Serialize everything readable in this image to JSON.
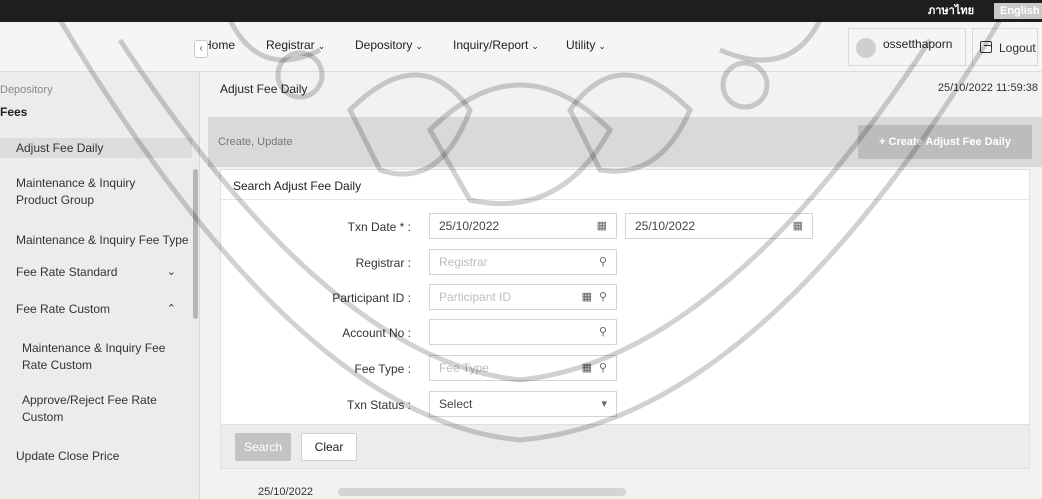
{
  "lang": {
    "thai": "ภาษาไทย",
    "english": "English"
  },
  "nav": {
    "items": [
      {
        "label": "Home",
        "has_menu": false
      },
      {
        "label": "Registrar",
        "has_menu": true
      },
      {
        "label": "Depository",
        "has_menu": true
      },
      {
        "label": "Inquiry/Report",
        "has_menu": true
      },
      {
        "label": "Utility",
        "has_menu": true
      }
    ],
    "user": "ossetthaporn",
    "logout": "Logout"
  },
  "sidebar": {
    "crumb": "Depository",
    "title": "Fees",
    "items": [
      {
        "label": "Adjust Fee Daily",
        "active": true
      },
      {
        "label": "Maintenance & Inquiry Product Group"
      },
      {
        "label": "Maintenance & Inquiry Fee Type"
      },
      {
        "label": "Fee Rate Standard",
        "arrow": "down"
      },
      {
        "label": "Fee Rate Custom",
        "arrow": "up"
      },
      {
        "label": "Maintenance & Inquiry Fee Rate Custom",
        "sub": true
      },
      {
        "label": "Approve/Reject Fee Rate Custom",
        "sub": true
      },
      {
        "label": "Update Close Price"
      }
    ]
  },
  "main": {
    "page_title": "Adjust Fee Daily",
    "timestamp": "25/10/2022 11:59:38",
    "action_label": "Create, Update",
    "create_button": "+ Create Adjust Fee Daily",
    "panel_title": "Search Adjust Fee Daily",
    "form": {
      "txn_date": {
        "label": "Txn Date * :",
        "from": "25/10/2022",
        "to": "25/10/2022"
      },
      "registrar": {
        "label": "Registrar :",
        "placeholder": "Registrar"
      },
      "participant_id": {
        "label": "Participant ID :",
        "placeholder": "Participant ID"
      },
      "account_no": {
        "label": "Account No :",
        "placeholder": ""
      },
      "fee_type": {
        "label": "Fee Type :",
        "placeholder": "Fee Type"
      },
      "txn_status": {
        "label": "Txn Status :",
        "value": "Select"
      }
    },
    "search_button": "Search",
    "clear_button": "Clear"
  },
  "footer": {
    "date": "25/10/2022"
  },
  "icons": {
    "calendar": "calendar-icon",
    "search": "search-icon",
    "lookup": "lookup-table-icon",
    "caret": "caret-down-icon",
    "logout": "logout-icon"
  }
}
